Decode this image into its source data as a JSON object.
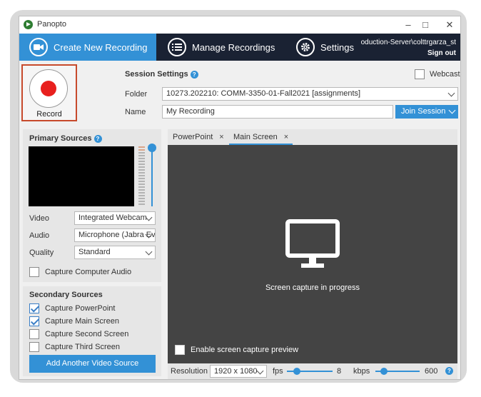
{
  "window": {
    "app_title": "Panopto"
  },
  "nav": {
    "tabs": [
      {
        "label": "Create New Recording",
        "icon": "camera-icon"
      },
      {
        "label": "Manage Recordings",
        "icon": "list-icon"
      },
      {
        "label": "Settings",
        "icon": "gear-icon"
      }
    ],
    "server": "oduction-Server\\colttrgarza_st",
    "sign_out": "Sign out"
  },
  "record": {
    "label": "Record"
  },
  "session": {
    "title": "Session Settings",
    "webcast_label": "Webcast",
    "webcast_checked": false,
    "folder_label": "Folder",
    "folder_value": "10273.202210: COMM-3350-01-Fall2021 [assignments]",
    "name_label": "Name",
    "name_value": "My Recording",
    "join_label": "Join Session"
  },
  "primary": {
    "title": "Primary Sources",
    "video_label": "Video",
    "video_value": "Integrated Webcam",
    "audio_label": "Audio",
    "audio_value": "Microphone (Jabra Evolve",
    "quality_label": "Quality",
    "quality_value": "Standard",
    "capture_audio_label": "Capture Computer Audio"
  },
  "secondary": {
    "title": "Secondary Sources",
    "items": [
      {
        "label": "Capture PowerPoint",
        "checked": true
      },
      {
        "label": "Capture Main Screen",
        "checked": true
      },
      {
        "label": "Capture Second Screen",
        "checked": false
      },
      {
        "label": "Capture Third Screen",
        "checked": false
      }
    ],
    "add_label": "Add Another Video Source"
  },
  "tabs": [
    {
      "label": "PowerPoint",
      "close": "×"
    },
    {
      "label": "Main Screen",
      "close": "×"
    }
  ],
  "stage": {
    "message": "Screen capture in progress",
    "preview_label": "Enable screen capture preview"
  },
  "bottom": {
    "resolution_label": "Resolution",
    "resolution_value": "1920 x 1080",
    "fps_label": "fps",
    "fps_value": "8",
    "kbps_label": "kbps",
    "kbps_value": "600"
  },
  "colors": {
    "accent": "#3391d6",
    "nav_bg": "#1a2233",
    "record": "#e8201e",
    "highlight": "#c74a2c"
  }
}
